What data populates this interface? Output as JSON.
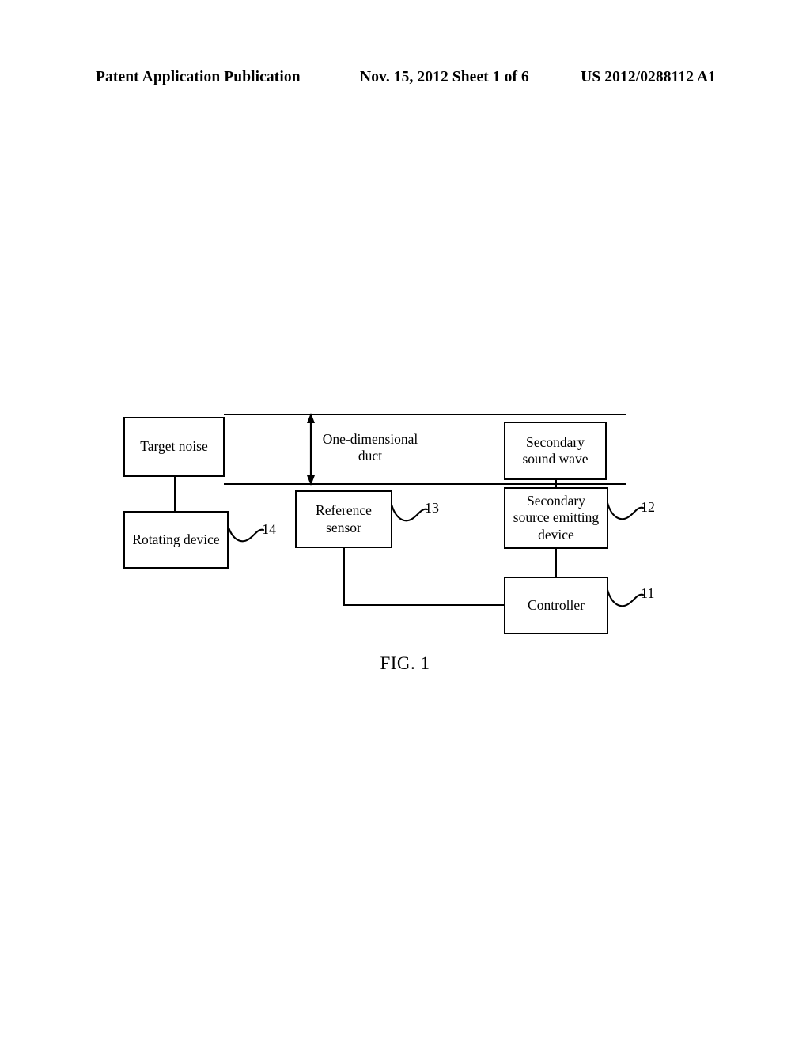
{
  "header": {
    "publication": "Patent Application Publication",
    "date_sheet": "Nov. 15, 2012  Sheet 1 of 6",
    "patent_number": "US 2012/0288112 A1"
  },
  "figure": {
    "caption": "FIG. 1",
    "duct_label_line1": "One-dimensional",
    "duct_label_line2": "duct",
    "blocks": [
      {
        "id": "target-noise",
        "label": "Target noise"
      },
      {
        "id": "rotating-device",
        "label": "Rotating device",
        "ref": "14"
      },
      {
        "id": "reference-sensor",
        "label_line1": "Reference",
        "label_line2": "sensor",
        "ref": "13"
      },
      {
        "id": "secondary-sound-wave",
        "label_line1": "Secondary",
        "label_line2": "sound wave"
      },
      {
        "id": "secondary-source",
        "label_line1": "Secondary",
        "label_line2": "source emitting",
        "label_line3": "device",
        "ref": "12"
      },
      {
        "id": "controller",
        "label": "Controller",
        "ref": "11"
      }
    ],
    "reference_numerals": {
      "controller": "11",
      "secondary_source_emitting_device": "12",
      "reference_sensor": "13",
      "rotating_device": "14"
    },
    "colors": {
      "line": "#000000",
      "background": "#ffffff"
    }
  }
}
